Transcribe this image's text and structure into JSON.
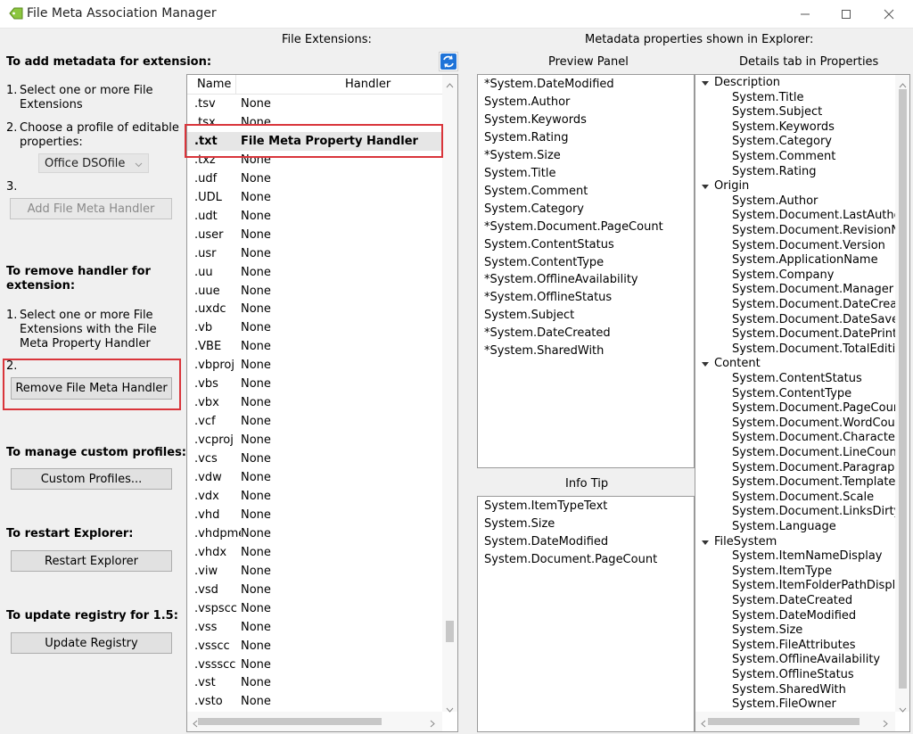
{
  "window": {
    "title": "File Meta Association Manager"
  },
  "left": {
    "add_heading": "To add metadata for extension:",
    "add_step1_num": "1.",
    "add_step1": "Select one or more File Extensions",
    "add_step2_num": "2.",
    "add_step2": "Choose a profile of editable properties:",
    "profile_value": "Office DSOfile",
    "add_step3_num": "3.",
    "add_button": "Add File Meta Handler",
    "remove_heading": "To remove handler for extension:",
    "remove_step1_num": "1.",
    "remove_step1": "Select one or more File Extensions with the File Meta Property Handler",
    "remove_step2_num": "2.",
    "remove_button": "Remove File Meta Handler",
    "profiles_heading": "To manage custom profiles:",
    "profiles_button": "Custom Profiles...",
    "restart_heading": "To restart Explorer:",
    "restart_button": "Restart Explorer",
    "update_heading": "To update registry for 1.5:",
    "update_button": "Update Registry"
  },
  "extensions": {
    "heading": "File Extensions:",
    "col_name": "Name",
    "col_handler": "Handler",
    "rows": [
      {
        "ext": ".tsv",
        "handler": "None"
      },
      {
        "ext": ".tsx",
        "handler": "None"
      },
      {
        "ext": ".txt",
        "handler": "File Meta Property Handler",
        "selected": true
      },
      {
        "ext": ".txz",
        "handler": "None"
      },
      {
        "ext": ".udf",
        "handler": "None"
      },
      {
        "ext": ".UDL",
        "handler": "None"
      },
      {
        "ext": ".udt",
        "handler": "None"
      },
      {
        "ext": ".user",
        "handler": "None"
      },
      {
        "ext": ".usr",
        "handler": "None"
      },
      {
        "ext": ".uu",
        "handler": "None"
      },
      {
        "ext": ".uue",
        "handler": "None"
      },
      {
        "ext": ".uxdc",
        "handler": "None"
      },
      {
        "ext": ".vb",
        "handler": "None"
      },
      {
        "ext": ".VBE",
        "handler": "None"
      },
      {
        "ext": ".vbproj",
        "handler": "None"
      },
      {
        "ext": ".vbs",
        "handler": "None"
      },
      {
        "ext": ".vbx",
        "handler": "None"
      },
      {
        "ext": ".vcf",
        "handler": "None"
      },
      {
        "ext": ".vcproj",
        "handler": "None"
      },
      {
        "ext": ".vcs",
        "handler": "None"
      },
      {
        "ext": ".vdw",
        "handler": "None"
      },
      {
        "ext": ".vdx",
        "handler": "None"
      },
      {
        "ext": ".vhd",
        "handler": "None"
      },
      {
        "ext": ".vhdpmem",
        "handler": "None"
      },
      {
        "ext": ".vhdx",
        "handler": "None"
      },
      {
        "ext": ".viw",
        "handler": "None"
      },
      {
        "ext": ".vsd",
        "handler": "None"
      },
      {
        "ext": ".vspscc",
        "handler": "None"
      },
      {
        "ext": ".vss",
        "handler": "None"
      },
      {
        "ext": ".vsscc",
        "handler": "None"
      },
      {
        "ext": ".vssscc",
        "handler": "None"
      },
      {
        "ext": ".vst",
        "handler": "None"
      },
      {
        "ext": ".vsto",
        "handler": "None"
      }
    ]
  },
  "metadata": {
    "heading": "Metadata properties shown in Explorer:",
    "preview_heading": "Preview Panel",
    "preview_items": [
      "*System.DateModified",
      "System.Author",
      "System.Keywords",
      "System.Rating",
      "*System.Size",
      "System.Title",
      "System.Comment",
      "System.Category",
      "*System.Document.PageCount",
      "System.ContentStatus",
      "System.ContentType",
      "*System.OfflineAvailability",
      "*System.OfflineStatus",
      "System.Subject",
      "*System.DateCreated",
      "*System.SharedWith"
    ],
    "infotip_heading": "Info Tip",
    "infotip_items": [
      "System.ItemTypeText",
      "System.Size",
      "System.DateModified",
      "System.Document.PageCount"
    ],
    "details_heading": "Details tab in Properties",
    "details_tree": [
      {
        "group": "Description",
        "items": [
          "System.Title",
          "System.Subject",
          "System.Keywords",
          "System.Category",
          "System.Comment",
          "System.Rating"
        ]
      },
      {
        "group": "Origin",
        "items": [
          "System.Author",
          "System.Document.LastAuthor",
          "System.Document.RevisionNumber",
          "System.Document.Version",
          "System.ApplicationName",
          "System.Company",
          "System.Document.Manager",
          "System.Document.DateCreated",
          "System.Document.DateSaved",
          "System.Document.DatePrinted",
          "System.Document.TotalEditingTime"
        ]
      },
      {
        "group": "Content",
        "items": [
          "System.ContentStatus",
          "System.ContentType",
          "System.Document.PageCount",
          "System.Document.WordCount",
          "System.Document.CharacterCount",
          "System.Document.LineCount",
          "System.Document.ParagraphCount",
          "System.Document.Template",
          "System.Document.Scale",
          "System.Document.LinksDirty",
          "System.Language"
        ]
      },
      {
        "group": "FileSystem",
        "items": [
          "System.ItemNameDisplay",
          "System.ItemType",
          "System.ItemFolderPathDisplay",
          "System.DateCreated",
          "System.DateModified",
          "System.Size",
          "System.FileAttributes",
          "System.OfflineAvailability",
          "System.OfflineStatus",
          "System.SharedWith",
          "System.FileOwner"
        ]
      }
    ]
  }
}
